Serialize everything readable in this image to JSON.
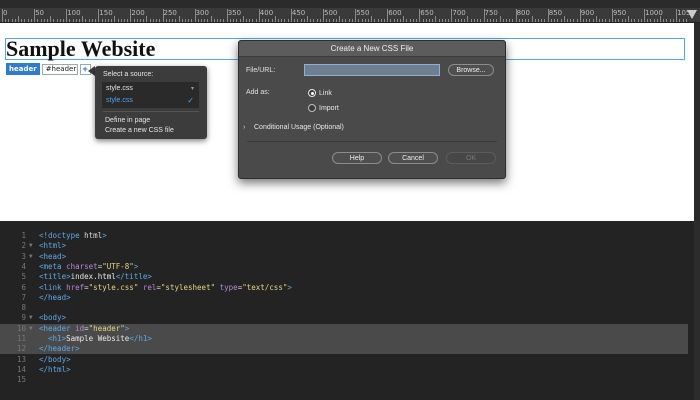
{
  "ruler": {
    "labels": [
      "0",
      "50",
      "100",
      "150",
      "200",
      "250",
      "300",
      "350",
      "400",
      "450",
      "500",
      "550",
      "600",
      "650",
      "700",
      "750",
      "800",
      "850",
      "900",
      "950",
      "1000",
      "1050"
    ]
  },
  "design": {
    "h1": "Sample Website",
    "tag_chip": "header",
    "tag_id": "#header",
    "tag_plus": "+"
  },
  "popover": {
    "title": "Select a source:",
    "options": [
      "style.css",
      "style.css"
    ],
    "items": [
      "Define in page",
      "Create a new CSS file"
    ]
  },
  "dialog": {
    "title": "Create a New CSS File",
    "file_label": "File/URL:",
    "file_value": "",
    "browse_label": "Browse...",
    "add_as_label": "Add as:",
    "radio_link": "Link",
    "radio_import": "Import",
    "conditional_label": "Conditional Usage (Optional)",
    "help_label": "Help",
    "cancel_label": "Cancel",
    "ok_label": "OK"
  },
  "code": {
    "line_numbers": [
      "1",
      "2",
      "3",
      "4",
      "5",
      "6",
      "7",
      "8",
      "9",
      "10",
      "11",
      "12",
      "13",
      "14",
      "15"
    ],
    "lines": [
      "<!doctype html>",
      "<html>",
      "<head>",
      "<meta charset=\"UTF-8\">",
      "<title>index.html</title>",
      "<link href=\"style.css\" rel=\"stylesheet\" type=\"text/css\">",
      "</head>",
      "",
      "<body>",
      "<header id=\"header\">",
      "  <h1>Sample Website</h1>",
      "</header>",
      "</body>",
      "</html>",
      ""
    ]
  },
  "colors": {
    "accent": "#2f7bd0",
    "selection": "#4a4a4a"
  }
}
